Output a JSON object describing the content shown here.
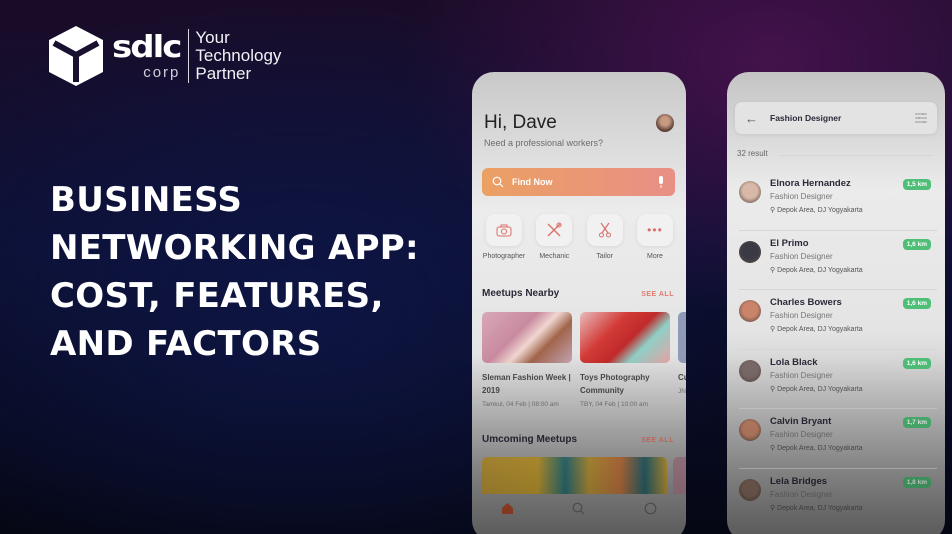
{
  "brand": {
    "name": "sdlc",
    "sub": "corp",
    "tagline": [
      "Your",
      "Technology",
      "Partner"
    ]
  },
  "headline": {
    "lines": [
      "BUSINESS",
      "NETWORKING APP:",
      "COST, FEATURES,",
      "AND FACTORS"
    ]
  },
  "phone_home": {
    "greeting": "Hi, Dave",
    "subtitle": "Need a professional workers?",
    "search": {
      "label": "Find Now",
      "icon": "search-icon",
      "mic_icon": "microphone-icon"
    },
    "categories": [
      {
        "label": "Photographer",
        "icon": "camera-icon"
      },
      {
        "label": "Mechanic",
        "icon": "tools-icon"
      },
      {
        "label": "Tailor",
        "icon": "scissors-icon"
      },
      {
        "label": "More",
        "icon": "more-icon"
      }
    ],
    "nearby": {
      "title": "Meetups Nearby",
      "see_all": "SEE ALL",
      "items": [
        {
          "title": "Sleman Fashion Week | 2019",
          "meta": "Tamkul, 04 Feb | 08:00 am"
        },
        {
          "title": "Toys Photography Community",
          "meta": "TBY, 04 Feb | 10:00 am"
        },
        {
          "title": "Cu Pr",
          "meta": "JN"
        }
      ]
    },
    "upcoming": {
      "title": "Umcoming Meetups",
      "see_all": "SEE ALL"
    },
    "tabs": [
      "home",
      "search",
      "chat"
    ]
  },
  "phone_search": {
    "title": "Fashion Designer",
    "result_count": "32 result",
    "people": [
      {
        "name": "Elnora Hernandez",
        "role": "Fashion Designer",
        "location": "Depok Area, DJ Yogyakarta",
        "distance": "1,5 km",
        "avatar_color": "#d8b8a8"
      },
      {
        "name": "El Primo",
        "role": "Fashion Designer",
        "location": "Depok Area, DJ Yogyakarta",
        "distance": "1,6 km",
        "avatar_color": "#3a3a44"
      },
      {
        "name": "Charles Bowers",
        "role": "Fashion Designer",
        "location": "Depok Area, DJ Yogyakarta",
        "distance": "1,6 km",
        "avatar_color": "#c9846a"
      },
      {
        "name": "Lola Black",
        "role": "Fashion Designer",
        "location": "Depok Area, DJ Yogyakarta",
        "distance": "1,6 km",
        "avatar_color": "#7a6a6a"
      },
      {
        "name": "Calvin Bryant",
        "role": "Fashion Designer",
        "location": "Depok Area, DJ Yogyakarta",
        "distance": "1,7 km",
        "avatar_color": "#c8866a"
      },
      {
        "name": "Lela Bridges",
        "role": "Fashion Designer",
        "location": "Depok Area, DJ Yogyakarta",
        "distance": "1,8 km",
        "avatar_color": "#8a6e60"
      }
    ]
  },
  "colors": {
    "accent_orange": "#eba063",
    "accent_pink": "#e98f86",
    "badge_green": "#4fbf78",
    "see_all": "#e07b6f"
  }
}
